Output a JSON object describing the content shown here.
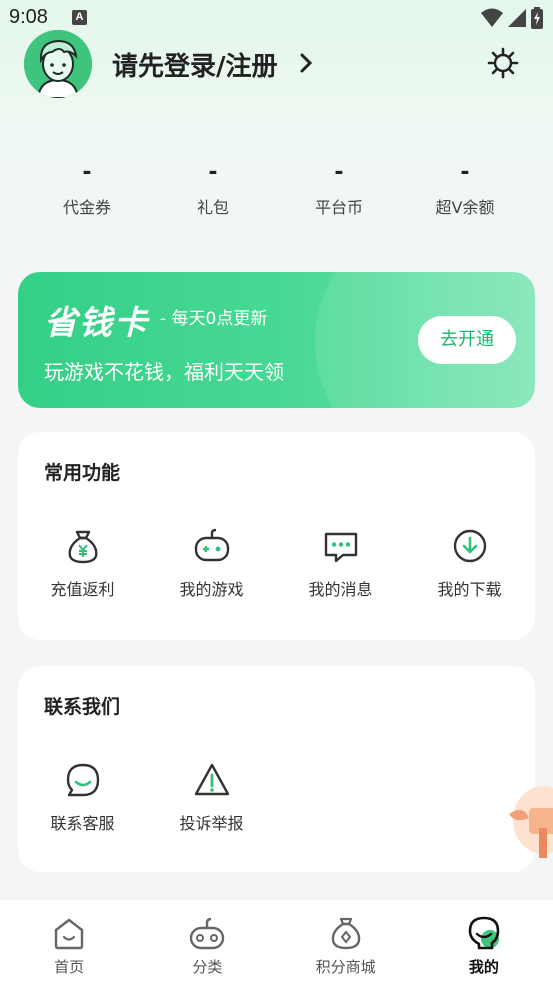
{
  "status_bar": {
    "time": "9:08",
    "indicator": "A"
  },
  "header": {
    "login_text": "请先登录/注册",
    "arrow_icon": "chevron-right-icon",
    "settings_icon": "gear-icon"
  },
  "stats": [
    {
      "value": "-",
      "label": "代金券"
    },
    {
      "value": "-",
      "label": "礼包"
    },
    {
      "value": "-",
      "label": "平台币"
    },
    {
      "value": "-",
      "label": "超V余额"
    }
  ],
  "save_card": {
    "title": "省钱卡",
    "subtitle": "- 每天0点更新",
    "description": "玩游戏不花钱，福利天天领",
    "button": "去开通",
    "accent": "#34cf86"
  },
  "common_functions": {
    "title": "常用功能",
    "items": [
      {
        "label": "充值返利",
        "icon": "money-bag-icon"
      },
      {
        "label": "我的游戏",
        "icon": "gamepad-icon"
      },
      {
        "label": "我的消息",
        "icon": "message-icon"
      },
      {
        "label": "我的下载",
        "icon": "download-icon"
      }
    ]
  },
  "contact": {
    "title": "联系我们",
    "items": [
      {
        "label": "联系客服",
        "icon": "customer-service-icon"
      },
      {
        "label": "投诉举报",
        "icon": "warning-icon"
      }
    ]
  },
  "bottom_nav": {
    "items": [
      {
        "label": "首页",
        "icon": "home-icon",
        "active": false
      },
      {
        "label": "分类",
        "icon": "category-icon",
        "active": false
      },
      {
        "label": "积分商城",
        "icon": "points-mall-icon",
        "active": false
      },
      {
        "label": "我的",
        "icon": "profile-icon",
        "active": true
      }
    ]
  },
  "colors": {
    "primary_green": "#3ec47d",
    "text_dark": "#222222",
    "background": "#f3f5f6"
  }
}
